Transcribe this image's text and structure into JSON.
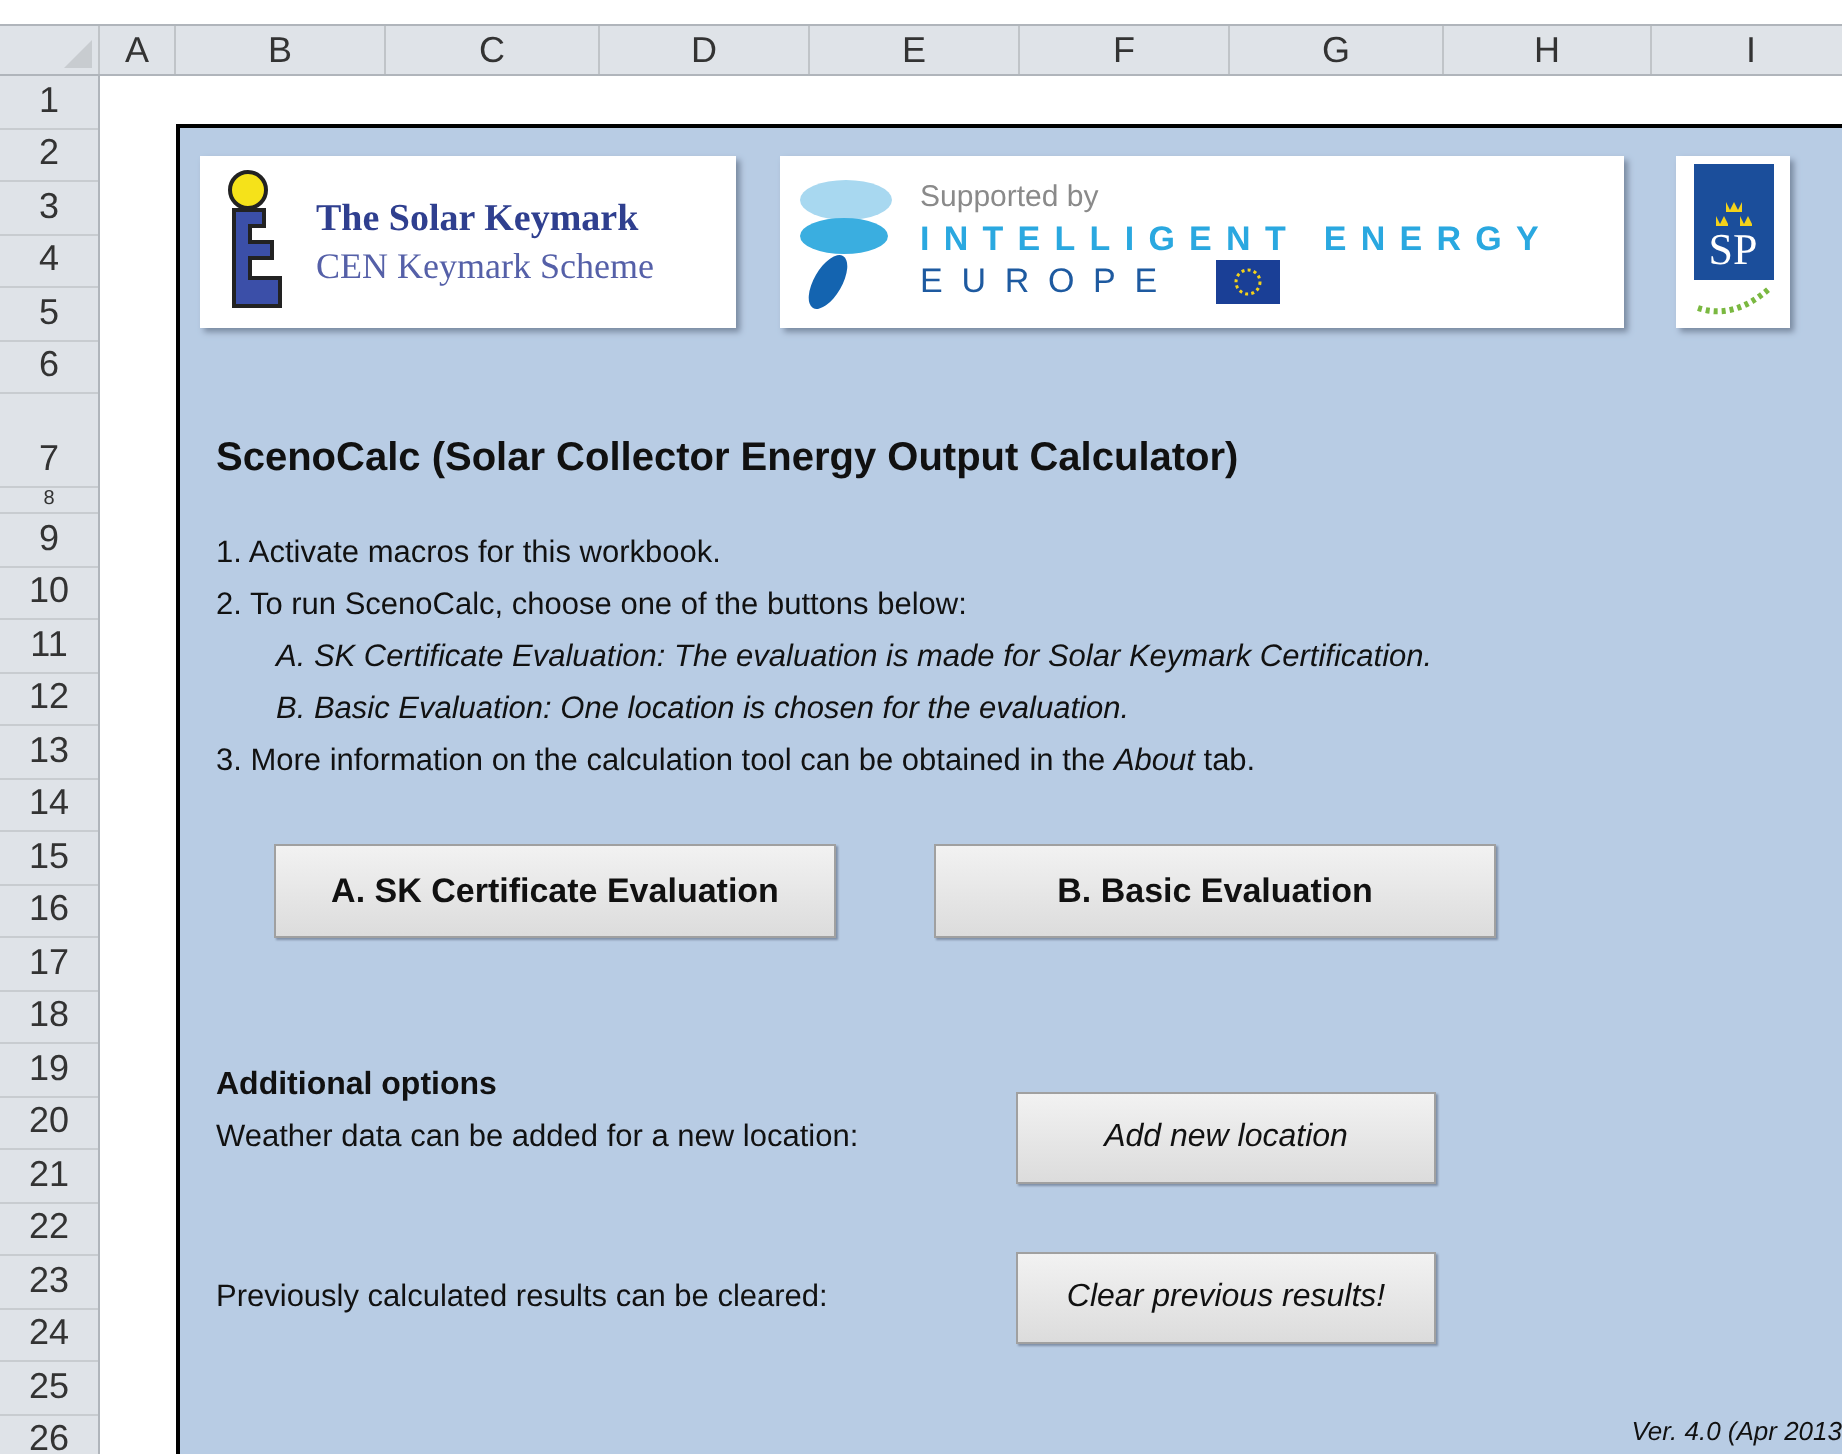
{
  "columns": [
    "A",
    "B",
    "C",
    "D",
    "E",
    "F",
    "G",
    "H",
    "I"
  ],
  "rows": [
    "1",
    "2",
    "3",
    "4",
    "5",
    "6",
    "7",
    "8",
    "9",
    "10",
    "11",
    "12",
    "13",
    "14",
    "15",
    "16",
    "17",
    "18",
    "19",
    "20",
    "21",
    "22",
    "23",
    "24",
    "25",
    "26"
  ],
  "logos": [
    {
      "kind": "keymark",
      "title": "The Solar Keymark",
      "subtitle": "CEN Keymark Scheme"
    },
    {
      "kind": "iee",
      "caption": "Supported by",
      "line1": "INTELLIGENT ENERGY",
      "line2": "EUROPE"
    },
    {
      "kind": "sp",
      "text": "SP"
    }
  ],
  "title": "ScenoCalc (Solar Collector Energy Output Calculator)",
  "steps": [
    {
      "kind": "step",
      "text": "1. Activate macros for this workbook."
    },
    {
      "kind": "step",
      "text": "2. To run ScenoCalc, choose one of the buttons below:"
    },
    {
      "kind": "sub",
      "text": "A. SK Certificate Evaluation: The evaluation is made for Solar Keymark Certification."
    },
    {
      "kind": "sub",
      "text": "B. Basic Evaluation: One location is chosen for the evaluation."
    },
    {
      "kind": "step",
      "text": "3. More information on the calculation tool can be obtained in the *About*  tab."
    }
  ],
  "main_buttons": [
    "A. SK Certificate Evaluation",
    "B. Basic Evaluation"
  ],
  "additional": {
    "heading": "Additional options",
    "options": [
      {
        "label": "Weather data can be added for a new location:",
        "button": "Add new location"
      },
      {
        "label": "Previously calculated results can be cleared:",
        "button": "Clear previous results!"
      }
    ]
  },
  "version": "Ver. 4.0 (Apr 2013"
}
